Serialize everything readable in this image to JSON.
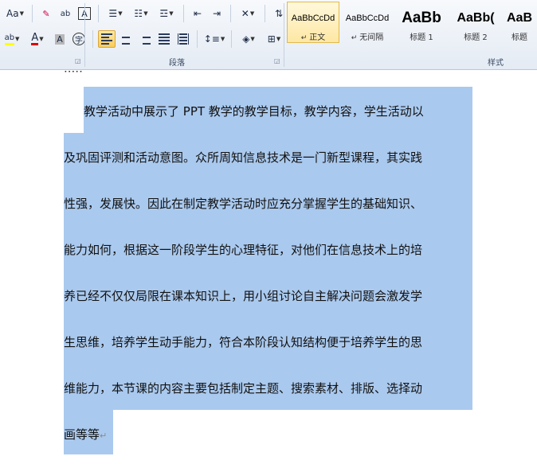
{
  "toolbar": {
    "font_size_btn": "Aa",
    "phonetic_btn": "ab",
    "char_border_btn": "A",
    "highlight_btn": "ab",
    "font_color_btn": "A",
    "char_shading_btn": "A",
    "enclosed_char_btn": "字"
  },
  "groups": {
    "paragraph_label": "段落",
    "styles_label": "样式"
  },
  "styles": [
    {
      "sample": "AaBbCcDd",
      "name": "正文",
      "selected": true
    },
    {
      "sample": "AaBbCcDd",
      "name": "无间隔",
      "selected": false
    },
    {
      "sample": "AaBb",
      "name": "标题 1",
      "selected": false
    },
    {
      "sample": "AaBb(",
      "name": "标题 2",
      "selected": false
    },
    {
      "sample": "AaB",
      "name": "标题",
      "selected": false
    }
  ],
  "document": {
    "lines": [
      "教学活动中展示了 PPT 教学的教学目标，教学内容，学生活动以",
      "及巩固评测和活动意图。众所周知信息技术是一门新型课程，其实践",
      "性强，发展快。因此在制定教学活动时应充分掌握学生的基础知识、",
      "能力如何，根据这一阶段学生的心理特征，对他们在信息技术上的培",
      "养已经不仅仅局限在课本知识上，用小组讨论自主解决问题会激发学",
      "生思维，培养学生动手能力，符合本阶段认知结构便于培养学生的思",
      "维能力，本节课的内容主要包括制定主题、搜索素材、排版、选择动",
      "画等等"
    ],
    "paragraph_mark": "↵"
  },
  "colors": {
    "selection": "#aac9ee",
    "highlight_yellow": "#ffff00",
    "font_color_red": "#e00000"
  }
}
